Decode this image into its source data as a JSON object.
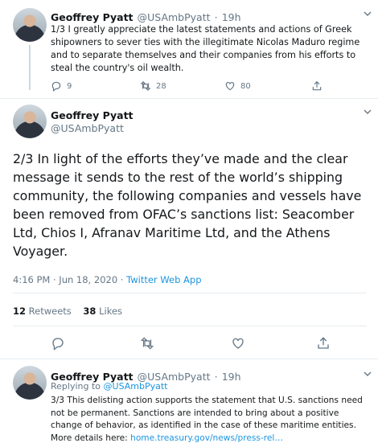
{
  "tweet1": {
    "name": "Geoffrey Pyatt",
    "handle": "@USAmbPyatt",
    "separator": "·",
    "time": "19h",
    "text": "1/3 I greatly appreciate the latest statements and actions of Greek shipowners to sever ties with the illegitimate Nicolas Maduro regime and to separate themselves and their companies from his efforts to steal the country's oil wealth.",
    "reply_count": "9",
    "retweet_count": "28",
    "like_count": "80"
  },
  "tweet2": {
    "name": "Geoffrey Pyatt",
    "handle": "@USAmbPyatt",
    "text": "2/3 In light of the efforts they’ve made and the clear message it sends to the rest of the world’s shipping community, the following companies and vessels have been removed from OFAC’s sanctions list: Seacomber Ltd, Chios I, Afranav Maritime Ltd, and the Athens Voyager.",
    "timestamp": "4:16 PM · Jun 18, 2020",
    "meta_separator": "·",
    "source": "Twitter Web App",
    "retweets_count": "12",
    "retweets_label": "Retweets",
    "likes_count": "38",
    "likes_label": "Likes"
  },
  "tweet3": {
    "name": "Geoffrey Pyatt",
    "handle": "@USAmbPyatt",
    "separator": "·",
    "time": "19h",
    "replying_prefix": "Replying to",
    "replying_to": "@USAmbPyatt",
    "text": "3/3 This delisting action supports the statement that U.S. sanctions need not be permanent. Sanctions are intended to bring about a positive change of behavior, as identified in the case of these maritime entities. More details here:",
    "link": "home.treasury.gov/news/press-rel…"
  },
  "colors": {
    "text": "#14171a",
    "secondary": "#657786",
    "accent": "#1b95e0",
    "divider": "#e6ecf0"
  },
  "icons": [
    "reply-icon",
    "retweet-icon",
    "like-icon",
    "share-icon",
    "chevron-down-icon"
  ]
}
